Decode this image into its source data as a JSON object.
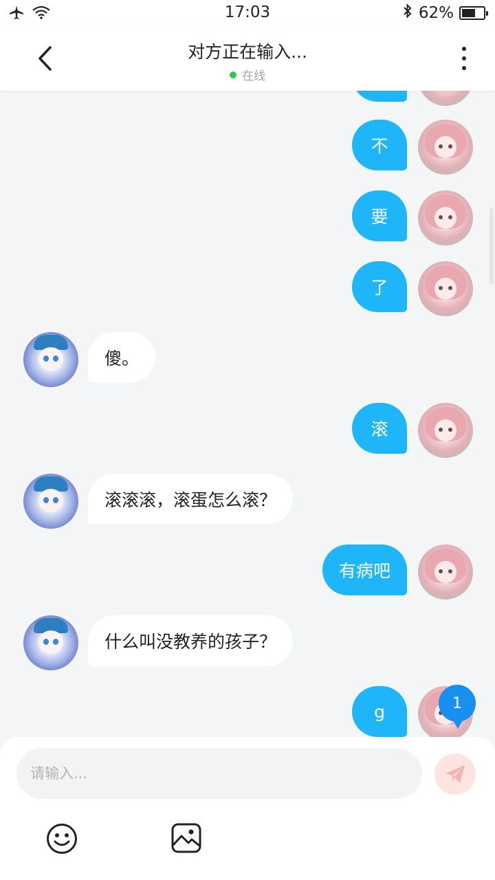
{
  "status_bar": {
    "time": "17:03",
    "battery_pct": "62%",
    "battery_level": 0.62
  },
  "header": {
    "title": "对方正在输入...",
    "presence": "在线",
    "presence_color": "#2ec84a"
  },
  "colors": {
    "outgoing_bubble": "#1eb6f8",
    "incoming_bubble": "#ffffff",
    "badge": "#1a8ff2"
  },
  "messages": [
    {
      "side": "out",
      "text": "不"
    },
    {
      "side": "out",
      "text": "要"
    },
    {
      "side": "out",
      "text": "了"
    },
    {
      "side": "in",
      "text": "傻。"
    },
    {
      "side": "out",
      "text": "滚"
    },
    {
      "side": "in",
      "text": "滚滚滚，滚蛋怎么滚？"
    },
    {
      "side": "out",
      "text": "有病吧"
    },
    {
      "side": "in",
      "text": "什么叫没教养的孩子？"
    },
    {
      "side": "out",
      "text": "g"
    }
  ],
  "unread_badge": "1",
  "composer": {
    "placeholder": "请输入..."
  },
  "icons": {
    "back": "chevron-left-icon",
    "more": "more-vertical-icon",
    "send": "send-icon",
    "emoji": "smiley-icon",
    "image": "image-icon"
  }
}
